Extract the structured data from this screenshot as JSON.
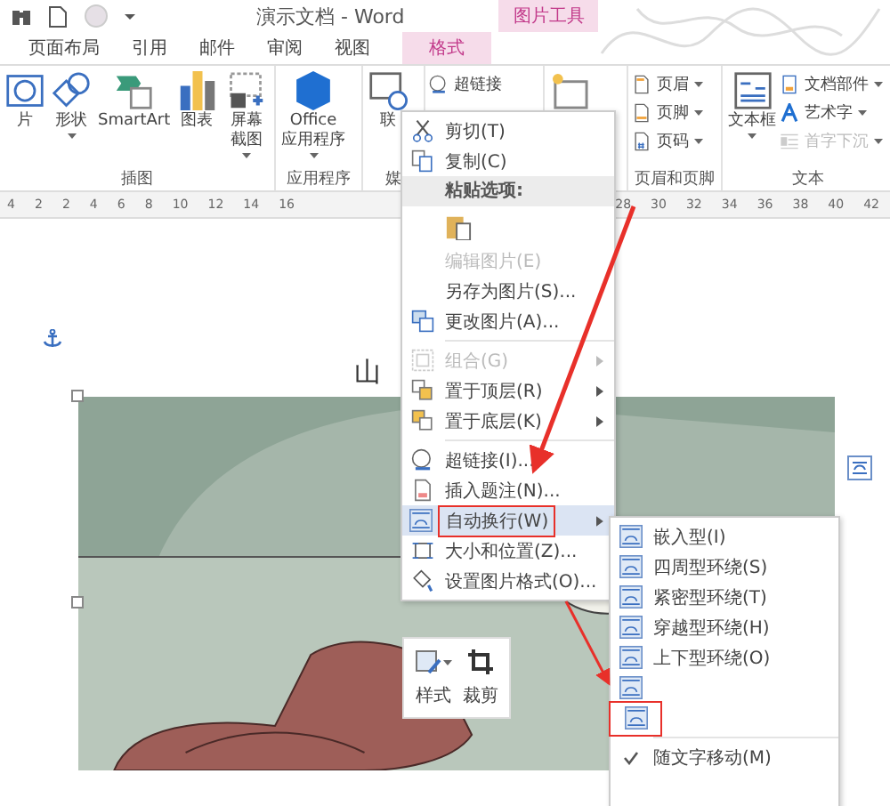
{
  "window": {
    "title": "演示文档 - Word",
    "context_tab_group": "图片工具"
  },
  "tabs": [
    {
      "label": "页面布局",
      "selected": false
    },
    {
      "label": "引用",
      "selected": false
    },
    {
      "label": "邮件",
      "selected": false
    },
    {
      "label": "审阅",
      "selected": false
    },
    {
      "label": "视图",
      "selected": false
    },
    {
      "label": "格式",
      "selected": false,
      "kind": "context"
    }
  ],
  "ribbon": {
    "groups": [
      {
        "label": "插图",
        "items": [
          {
            "label": "片",
            "dropdown": false
          },
          {
            "label": "形状",
            "dropdown": true
          },
          {
            "label": "SmartArt",
            "dropdown": false
          },
          {
            "label": "图表",
            "dropdown": false
          },
          {
            "label": "屏幕截图",
            "dropdown": true
          }
        ]
      },
      {
        "label": "应用程序",
        "items": [
          {
            "label": "Office\n应用程序",
            "dropdown": true
          }
        ]
      },
      {
        "label": "媒",
        "items": [
          {
            "label": "联",
            "dropdown": false
          }
        ]
      },
      {
        "items": [
          {
            "label": "超链接",
            "dropdown": false,
            "kind": "small"
          }
        ]
      },
      {
        "items": [
          {
            "dropdown": false
          }
        ]
      },
      {
        "label": "页眉和页脚",
        "items": [
          {
            "label": "页眉",
            "dropdown": true,
            "kind": "small"
          },
          {
            "label": "页脚",
            "dropdown": true,
            "kind": "small"
          },
          {
            "label": "页码",
            "dropdown": true,
            "kind": "small"
          }
        ]
      },
      {
        "label": "文本",
        "items": [
          {
            "label": "文本框",
            "dropdown": true
          },
          {
            "label": "文档部件",
            "dropdown": true,
            "kind": "small"
          },
          {
            "label": "艺术字",
            "dropdown": true,
            "kind": "small"
          },
          {
            "label": "首字下沉",
            "dropdown": true,
            "kind": "small",
            "disabled": true
          }
        ]
      }
    ]
  },
  "ruler": {
    "left_labels": [
      "4",
      "2",
      "2",
      "4",
      "6",
      "8",
      "10",
      "12",
      "14",
      "16"
    ],
    "right_labels": [
      "28",
      "30",
      "32",
      "34",
      "36",
      "38",
      "40",
      "42"
    ]
  },
  "document": {
    "heading": "山"
  },
  "context_menu": {
    "items": [
      {
        "kind": "item",
        "label": "剪切(T)",
        "disabled": false,
        "submenu": false,
        "selected": false
      },
      {
        "kind": "item",
        "label": "复制(C)",
        "disabled": false,
        "submenu": false,
        "selected": false
      },
      {
        "kind": "header",
        "label": "粘贴选项:"
      },
      {
        "kind": "paste"
      },
      {
        "kind": "item",
        "label": "编辑图片(E)",
        "disabled": true,
        "submenu": false,
        "selected": false
      },
      {
        "kind": "item",
        "label": "另存为图片(S)...",
        "disabled": false,
        "submenu": false,
        "selected": false
      },
      {
        "kind": "item",
        "label": "更改图片(A)...",
        "disabled": false,
        "submenu": false,
        "selected": false
      },
      {
        "kind": "separator"
      },
      {
        "kind": "item",
        "label": "组合(G)",
        "disabled": true,
        "submenu": true,
        "selected": false
      },
      {
        "kind": "item",
        "label": "置于顶层(R)",
        "disabled": false,
        "submenu": true,
        "selected": false
      },
      {
        "kind": "item",
        "label": "置于底层(K)",
        "disabled": false,
        "submenu": true,
        "selected": false
      },
      {
        "kind": "separator"
      },
      {
        "kind": "item",
        "label": "超链接(I)...",
        "disabled": false,
        "submenu": false,
        "selected": false
      },
      {
        "kind": "item",
        "label": "插入题注(N)...",
        "disabled": false,
        "submenu": false,
        "selected": false
      },
      {
        "kind": "item",
        "label": "自动换行(W)",
        "disabled": false,
        "submenu": true,
        "selected": true,
        "annotated": true
      },
      {
        "kind": "item",
        "label": "大小和位置(Z)...",
        "disabled": false,
        "submenu": false,
        "selected": false
      },
      {
        "kind": "item",
        "label": "设置图片格式(O)...",
        "disabled": false,
        "submenu": false,
        "selected": false
      }
    ]
  },
  "wrap_submenu": {
    "items": [
      {
        "kind": "item",
        "label": "嵌入型(I)",
        "checked": false
      },
      {
        "kind": "item",
        "label": "四周型环绕(S)",
        "checked": false
      },
      {
        "kind": "item",
        "label": "紧密型环绕(T)",
        "checked": false
      },
      {
        "kind": "item",
        "label": "穿越型环绕(H)",
        "checked": false
      },
      {
        "kind": "item",
        "label": "上下型环绕(O)",
        "checked": false
      },
      {
        "kind": "icon_only",
        "checked": false,
        "annotated": false
      },
      {
        "kind": "icon_only",
        "checked": false,
        "annotated": true
      },
      {
        "kind": "separator"
      },
      {
        "kind": "item",
        "label": "随文字移动(M)",
        "checked": true
      }
    ]
  },
  "mini_toolbar": {
    "buttons": [
      {
        "label": "样式",
        "dropdown": true
      },
      {
        "label": "裁剪",
        "dropdown": false
      }
    ]
  }
}
